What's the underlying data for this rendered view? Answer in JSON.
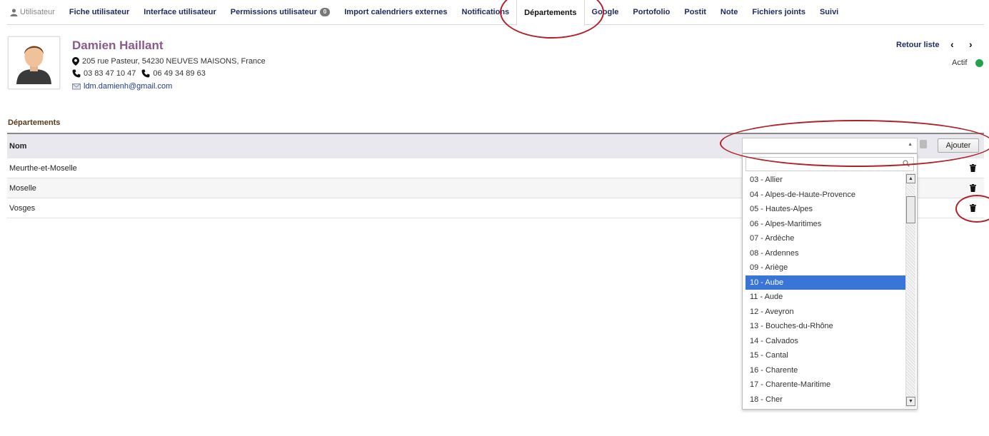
{
  "tabs": [
    {
      "label": "Utilisateur"
    },
    {
      "label": "Fiche utilisateur"
    },
    {
      "label": "Interface utilisateur"
    },
    {
      "label": "Permissions utilisateur",
      "badge": "0"
    },
    {
      "label": "Import calendriers externes"
    },
    {
      "label": "Notifications"
    },
    {
      "label": "Départements",
      "active": true
    },
    {
      "label": "Google"
    },
    {
      "label": "Portofolio"
    },
    {
      "label": "Postit"
    },
    {
      "label": "Note"
    },
    {
      "label": "Fichiers joints"
    },
    {
      "label": "Suivi"
    }
  ],
  "user": {
    "name": "Damien Haillant",
    "address": "205 rue Pasteur, 54230 NEUVES MAISONS, France",
    "phone1": "03 83 47 10 47",
    "phone2": "06 49 34 89 63",
    "email": "ldm.damienh@gmail.com"
  },
  "header_actions": {
    "back_label": "Retour liste",
    "prev_arrow": "‹",
    "next_arrow": "›",
    "status": "Actif",
    "status_color": "#22a24a"
  },
  "section": {
    "title": "Départements",
    "column_name": "Nom",
    "add_button": "Ajouter",
    "rows": [
      "Meurthe-et-Moselle",
      "Moselle",
      "Vosges"
    ]
  },
  "dropdown": {
    "selected": "10 - Aube",
    "options": [
      "03 - Allier",
      "04 - Alpes-de-Haute-Provence",
      "05 - Hautes-Alpes",
      "06 - Alpes-Maritimes",
      "07 - Ardèche",
      "08 - Ardennes",
      "09 - Ariège",
      "10 - Aube",
      "11 - Aude",
      "12 - Aveyron",
      "13 - Bouches-du-Rhône",
      "14 - Calvados",
      "15 - Cantal",
      "16 - Charente",
      "17 - Charente-Maritime",
      "18 - Cher"
    ]
  },
  "colors": {
    "tab_text": "#1f2a5c",
    "name": "#8a5a8c",
    "selected": "#3875d7",
    "annotation": "#b2202a"
  }
}
